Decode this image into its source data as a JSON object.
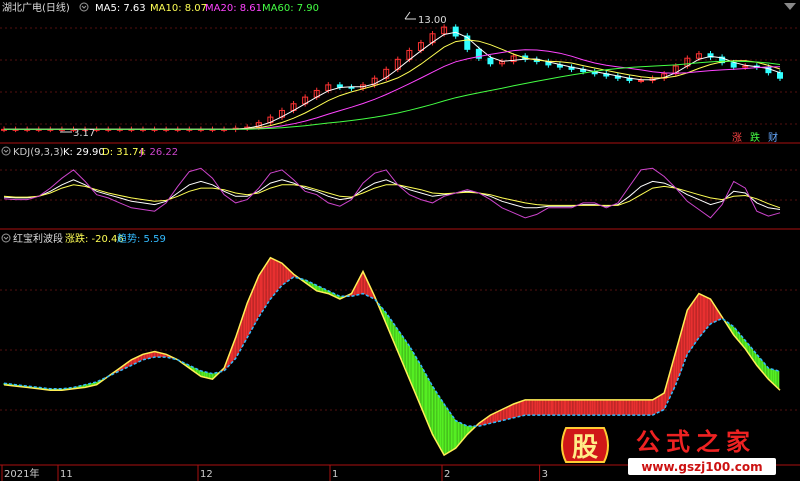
{
  "header": {
    "title": "湖北广电(日线)",
    "ma_labels": [
      {
        "name": "MA5",
        "value": "MA5: 7.63",
        "color": "#ffffff"
      },
      {
        "name": "MA10",
        "value": "MA10: 8.07",
        "color": "#ffff55"
      },
      {
        "name": "MA20",
        "value": "MA20: 8.61",
        "color": "#ff44ff"
      },
      {
        "name": "MA60",
        "value": "MA60: 7.90",
        "color": "#44ff44"
      }
    ],
    "high_marker": "13.00",
    "low_marker": "3.17"
  },
  "side_buttons": [
    {
      "label": "涨",
      "color": "#ff4444"
    },
    {
      "label": "跌",
      "color": "#44ff44"
    },
    {
      "label": "财",
      "color": "#66aaff"
    }
  ],
  "kdj_panel": {
    "title": "KDJ(9,3,3)",
    "k": "K: 29.90",
    "d": "D: 31.74",
    "j": "J: 26.22"
  },
  "wave_panel": {
    "title": "红宝利波段",
    "rise_label": "涨跌: -20.46",
    "trend_label": "趋势: 5.59"
  },
  "x_axis": {
    "labels": [
      "2021年",
      "11",
      "12",
      "1",
      "2",
      "3"
    ]
  },
  "watermark": {
    "icon_char": "股",
    "text": "公式之家",
    "url": "www.gszj100.com"
  },
  "colors": {
    "up": "#ff3333",
    "down": "#33ffff",
    "ma5": "#ffffff",
    "ma10": "#ffff55",
    "ma20": "#ff44ff",
    "ma60": "#44ff44",
    "k": "#ffffff",
    "d": "#ffff55",
    "j": "#cc44cc",
    "wave_red": "#e83030",
    "wave_green": "#55ee22",
    "wave_trend": "#33bbff"
  },
  "chart_data": [
    {
      "type": "candlestick",
      "title": "湖北广电(日线)",
      "series_close": [
        3.2,
        3.2,
        3.2,
        3.2,
        3.2,
        3.2,
        3.2,
        3.2,
        3.2,
        3.2,
        3.2,
        3.2,
        3.2,
        3.2,
        3.2,
        3.2,
        3.2,
        3.2,
        3.2,
        3.2,
        3.3,
        3.4,
        3.8,
        4.3,
        4.9,
        5.5,
        6.1,
        6.7,
        7.2,
        7.0,
        6.9,
        7.2,
        7.8,
        8.6,
        9.5,
        10.3,
        11.0,
        11.8,
        12.4,
        11.6,
        10.4,
        9.6,
        9.1,
        9.3,
        9.8,
        9.5,
        9.3,
        9.0,
        8.8,
        8.6,
        8.4,
        8.2,
        8.0,
        7.8,
        7.6,
        7.6,
        7.8,
        8.2,
        8.9,
        9.6,
        10.0,
        9.7,
        9.2,
        8.8,
        8.9,
        8.8,
        8.3,
        7.8
      ],
      "ma_series": [
        {
          "name": "MA5"
        },
        {
          "name": "MA10"
        },
        {
          "name": "MA20"
        },
        {
          "name": "MA60"
        }
      ]
    },
    {
      "type": "line",
      "title": "KDJ(9,3,3)",
      "series": [
        {
          "name": "K",
          "values": [
            45,
            44,
            44,
            46,
            52,
            60,
            66,
            60,
            52,
            48,
            44,
            40,
            38,
            36,
            40,
            50,
            60,
            64,
            60,
            52,
            46,
            46,
            52,
            62,
            66,
            62,
            56,
            52,
            46,
            42,
            44,
            54,
            62,
            66,
            60,
            54,
            50,
            46,
            48,
            50,
            52,
            50,
            46,
            40,
            36,
            32,
            32,
            34,
            34,
            34,
            36,
            36,
            34,
            36,
            46,
            58,
            64,
            62,
            56,
            48,
            42,
            36,
            40,
            52,
            50,
            38,
            32,
            30
          ]
        },
        {
          "name": "D",
          "values": [
            46,
            45,
            45,
            46,
            50,
            56,
            60,
            58,
            54,
            50,
            47,
            44,
            42,
            40,
            41,
            46,
            52,
            56,
            56,
            54,
            50,
            48,
            50,
            56,
            60,
            60,
            58,
            54,
            50,
            46,
            45,
            50,
            56,
            60,
            60,
            57,
            54,
            50,
            49,
            50,
            51,
            50,
            48,
            44,
            41,
            38,
            36,
            35,
            35,
            35,
            35,
            35,
            35,
            35,
            40,
            48,
            56,
            58,
            56,
            52,
            48,
            44,
            42,
            46,
            47,
            43,
            37,
            32
          ]
        },
        {
          "name": "J",
          "values": [
            43,
            42,
            42,
            46,
            56,
            68,
            78,
            64,
            48,
            44,
            38,
            32,
            30,
            28,
            38,
            58,
            76,
            80,
            68,
            48,
            38,
            42,
            56,
            74,
            78,
            66,
            52,
            48,
            38,
            34,
            42,
            62,
            74,
            78,
            60,
            48,
            42,
            38,
            46,
            50,
            54,
            50,
            42,
            32,
            26,
            20,
            24,
            32,
            32,
            32,
            38,
            38,
            32,
            38,
            58,
            78,
            80,
            70,
            56,
            40,
            30,
            20,
            36,
            64,
            56,
            28,
            22,
            26
          ]
        }
      ]
    },
    {
      "type": "area",
      "title": "红宝利波段",
      "series": [
        {
          "name": "涨跌",
          "values": [
            -4,
            -5,
            -6,
            -7,
            -8,
            -8,
            -7,
            -6,
            -4,
            2,
            8,
            14,
            18,
            20,
            18,
            14,
            8,
            2,
            0,
            8,
            30,
            55,
            75,
            88,
            84,
            76,
            70,
            64,
            62,
            58,
            62,
            78,
            60,
            40,
            20,
            0,
            -20,
            -40,
            -55,
            -50,
            -40,
            -32,
            -26,
            -22,
            -18,
            -15,
            -15,
            -15,
            -15,
            -15,
            -15,
            -15,
            -15,
            -15,
            -15,
            -15,
            -15,
            -10,
            20,
            50,
            62,
            58,
            45,
            32,
            22,
            10,
            0,
            -8
          ]
        },
        {
          "name": "趋势",
          "values": [
            -3,
            -4,
            -5,
            -6,
            -7,
            -7,
            -6,
            -4,
            -2,
            2,
            6,
            10,
            14,
            16,
            16,
            14,
            10,
            6,
            4,
            6,
            15,
            30,
            45,
            58,
            68,
            74,
            72,
            68,
            64,
            60,
            60,
            62,
            58,
            48,
            36,
            24,
            10,
            -5,
            -18,
            -30,
            -34,
            -34,
            -32,
            -30,
            -28,
            -26,
            -26,
            -26,
            -26,
            -26,
            -26,
            -26,
            -26,
            -26,
            -26,
            -26,
            -26,
            -22,
            -4,
            18,
            30,
            40,
            44,
            38,
            28,
            18,
            8,
            5.59
          ]
        }
      ]
    }
  ]
}
